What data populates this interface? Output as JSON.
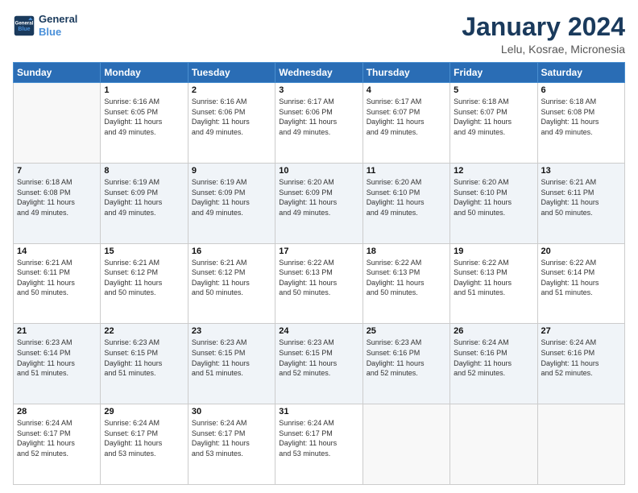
{
  "logo": {
    "line1": "General",
    "line2": "Blue"
  },
  "title": "January 2024",
  "subtitle": "Lelu, Kosrae, Micronesia",
  "headers": [
    "Sunday",
    "Monday",
    "Tuesday",
    "Wednesday",
    "Thursday",
    "Friday",
    "Saturday"
  ],
  "weeks": [
    [
      {
        "num": "",
        "info": ""
      },
      {
        "num": "1",
        "info": "Sunrise: 6:16 AM\nSunset: 6:05 PM\nDaylight: 11 hours\nand 49 minutes."
      },
      {
        "num": "2",
        "info": "Sunrise: 6:16 AM\nSunset: 6:06 PM\nDaylight: 11 hours\nand 49 minutes."
      },
      {
        "num": "3",
        "info": "Sunrise: 6:17 AM\nSunset: 6:06 PM\nDaylight: 11 hours\nand 49 minutes."
      },
      {
        "num": "4",
        "info": "Sunrise: 6:17 AM\nSunset: 6:07 PM\nDaylight: 11 hours\nand 49 minutes."
      },
      {
        "num": "5",
        "info": "Sunrise: 6:18 AM\nSunset: 6:07 PM\nDaylight: 11 hours\nand 49 minutes."
      },
      {
        "num": "6",
        "info": "Sunrise: 6:18 AM\nSunset: 6:08 PM\nDaylight: 11 hours\nand 49 minutes."
      }
    ],
    [
      {
        "num": "7",
        "info": "Sunrise: 6:18 AM\nSunset: 6:08 PM\nDaylight: 11 hours\nand 49 minutes."
      },
      {
        "num": "8",
        "info": "Sunrise: 6:19 AM\nSunset: 6:09 PM\nDaylight: 11 hours\nand 49 minutes."
      },
      {
        "num": "9",
        "info": "Sunrise: 6:19 AM\nSunset: 6:09 PM\nDaylight: 11 hours\nand 49 minutes."
      },
      {
        "num": "10",
        "info": "Sunrise: 6:20 AM\nSunset: 6:09 PM\nDaylight: 11 hours\nand 49 minutes."
      },
      {
        "num": "11",
        "info": "Sunrise: 6:20 AM\nSunset: 6:10 PM\nDaylight: 11 hours\nand 49 minutes."
      },
      {
        "num": "12",
        "info": "Sunrise: 6:20 AM\nSunset: 6:10 PM\nDaylight: 11 hours\nand 50 minutes."
      },
      {
        "num": "13",
        "info": "Sunrise: 6:21 AM\nSunset: 6:11 PM\nDaylight: 11 hours\nand 50 minutes."
      }
    ],
    [
      {
        "num": "14",
        "info": "Sunrise: 6:21 AM\nSunset: 6:11 PM\nDaylight: 11 hours\nand 50 minutes."
      },
      {
        "num": "15",
        "info": "Sunrise: 6:21 AM\nSunset: 6:12 PM\nDaylight: 11 hours\nand 50 minutes."
      },
      {
        "num": "16",
        "info": "Sunrise: 6:21 AM\nSunset: 6:12 PM\nDaylight: 11 hours\nand 50 minutes."
      },
      {
        "num": "17",
        "info": "Sunrise: 6:22 AM\nSunset: 6:13 PM\nDaylight: 11 hours\nand 50 minutes."
      },
      {
        "num": "18",
        "info": "Sunrise: 6:22 AM\nSunset: 6:13 PM\nDaylight: 11 hours\nand 50 minutes."
      },
      {
        "num": "19",
        "info": "Sunrise: 6:22 AM\nSunset: 6:13 PM\nDaylight: 11 hours\nand 51 minutes."
      },
      {
        "num": "20",
        "info": "Sunrise: 6:22 AM\nSunset: 6:14 PM\nDaylight: 11 hours\nand 51 minutes."
      }
    ],
    [
      {
        "num": "21",
        "info": "Sunrise: 6:23 AM\nSunset: 6:14 PM\nDaylight: 11 hours\nand 51 minutes."
      },
      {
        "num": "22",
        "info": "Sunrise: 6:23 AM\nSunset: 6:15 PM\nDaylight: 11 hours\nand 51 minutes."
      },
      {
        "num": "23",
        "info": "Sunrise: 6:23 AM\nSunset: 6:15 PM\nDaylight: 11 hours\nand 51 minutes."
      },
      {
        "num": "24",
        "info": "Sunrise: 6:23 AM\nSunset: 6:15 PM\nDaylight: 11 hours\nand 52 minutes."
      },
      {
        "num": "25",
        "info": "Sunrise: 6:23 AM\nSunset: 6:16 PM\nDaylight: 11 hours\nand 52 minutes."
      },
      {
        "num": "26",
        "info": "Sunrise: 6:24 AM\nSunset: 6:16 PM\nDaylight: 11 hours\nand 52 minutes."
      },
      {
        "num": "27",
        "info": "Sunrise: 6:24 AM\nSunset: 6:16 PM\nDaylight: 11 hours\nand 52 minutes."
      }
    ],
    [
      {
        "num": "28",
        "info": "Sunrise: 6:24 AM\nSunset: 6:17 PM\nDaylight: 11 hours\nand 52 minutes."
      },
      {
        "num": "29",
        "info": "Sunrise: 6:24 AM\nSunset: 6:17 PM\nDaylight: 11 hours\nand 53 minutes."
      },
      {
        "num": "30",
        "info": "Sunrise: 6:24 AM\nSunset: 6:17 PM\nDaylight: 11 hours\nand 53 minutes."
      },
      {
        "num": "31",
        "info": "Sunrise: 6:24 AM\nSunset: 6:17 PM\nDaylight: 11 hours\nand 53 minutes."
      },
      {
        "num": "",
        "info": ""
      },
      {
        "num": "",
        "info": ""
      },
      {
        "num": "",
        "info": ""
      }
    ]
  ]
}
